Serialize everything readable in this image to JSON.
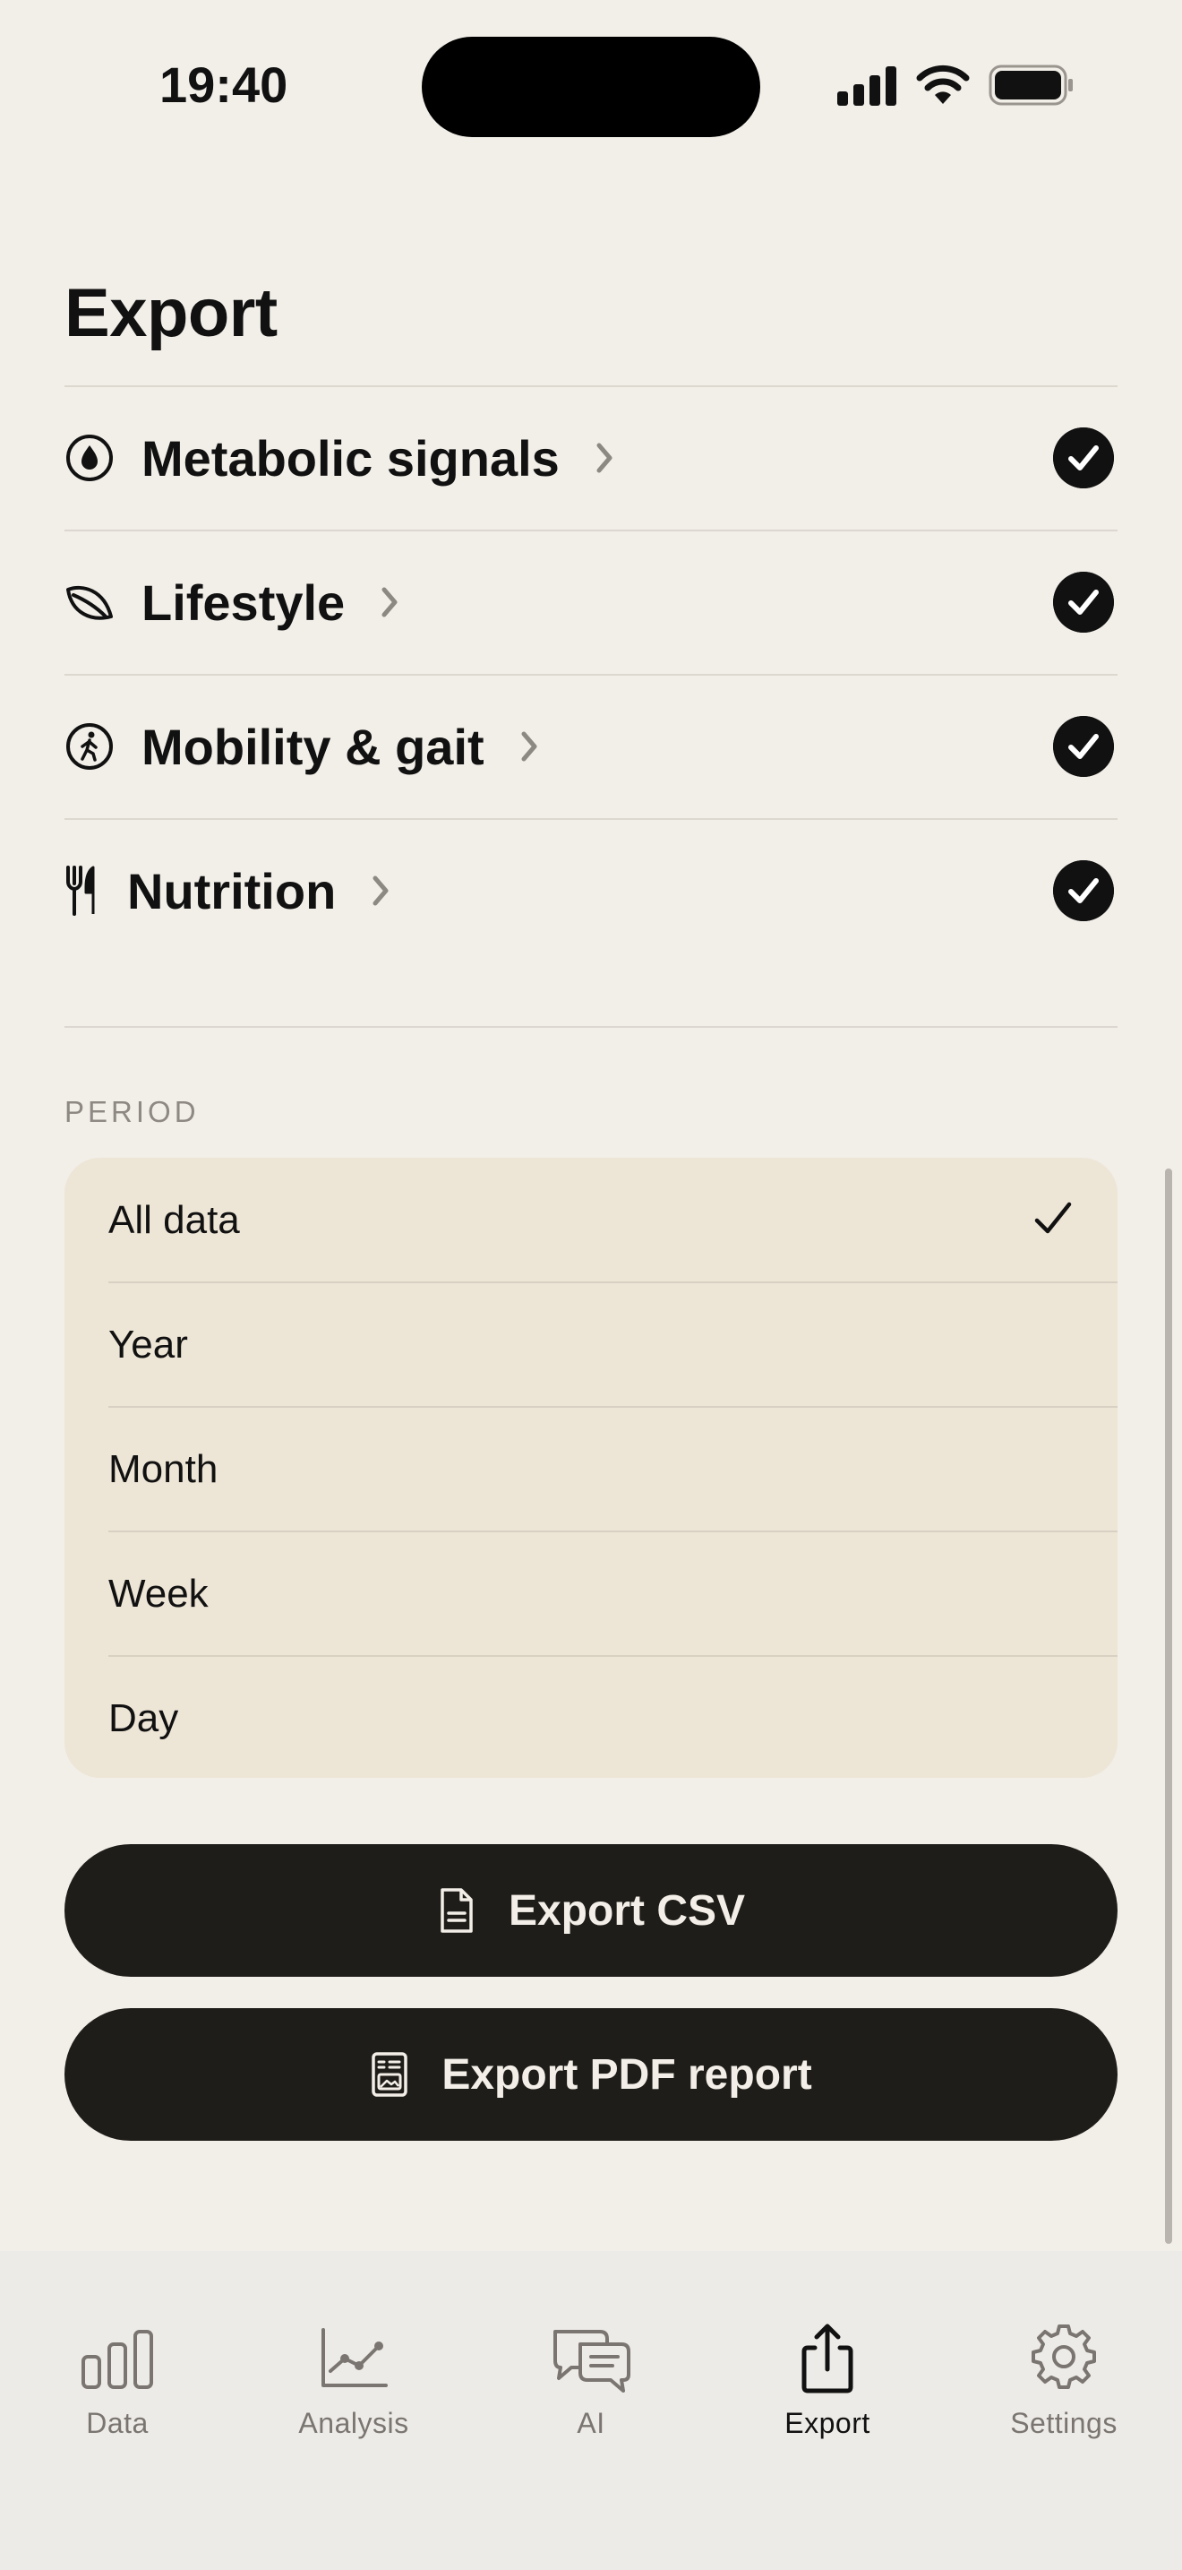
{
  "status_bar": {
    "time": "19:40"
  },
  "page": {
    "title": "Export"
  },
  "categories": [
    {
      "label": "Metabolic signals",
      "icon": "drop-icon",
      "checked": true
    },
    {
      "label": "Lifestyle",
      "icon": "leaf-icon",
      "checked": true
    },
    {
      "label": "Mobility & gait",
      "icon": "walking-figure-icon",
      "checked": true
    },
    {
      "label": "Nutrition",
      "icon": "fork-knife-icon",
      "checked": true
    }
  ],
  "period": {
    "section_label": "PERIOD",
    "options": [
      "All data",
      "Year",
      "Month",
      "Week",
      "Day"
    ],
    "selected": "All data"
  },
  "actions": {
    "export_csv": "Export CSV",
    "export_pdf": "Export PDF report"
  },
  "tabs": [
    {
      "label": "Data",
      "icon": "bar-chart-icon"
    },
    {
      "label": "Analysis",
      "icon": "line-chart-icon"
    },
    {
      "label": "AI",
      "icon": "chat-bubbles-icon"
    },
    {
      "label": "Export",
      "icon": "share-icon",
      "active": true
    },
    {
      "label": "Settings",
      "icon": "gear-icon"
    }
  ],
  "colors": {
    "background": "#F2EEE8",
    "card": "#EDE5D6",
    "button": "#1F1D19",
    "tab_bar": "#EDEBE7"
  }
}
